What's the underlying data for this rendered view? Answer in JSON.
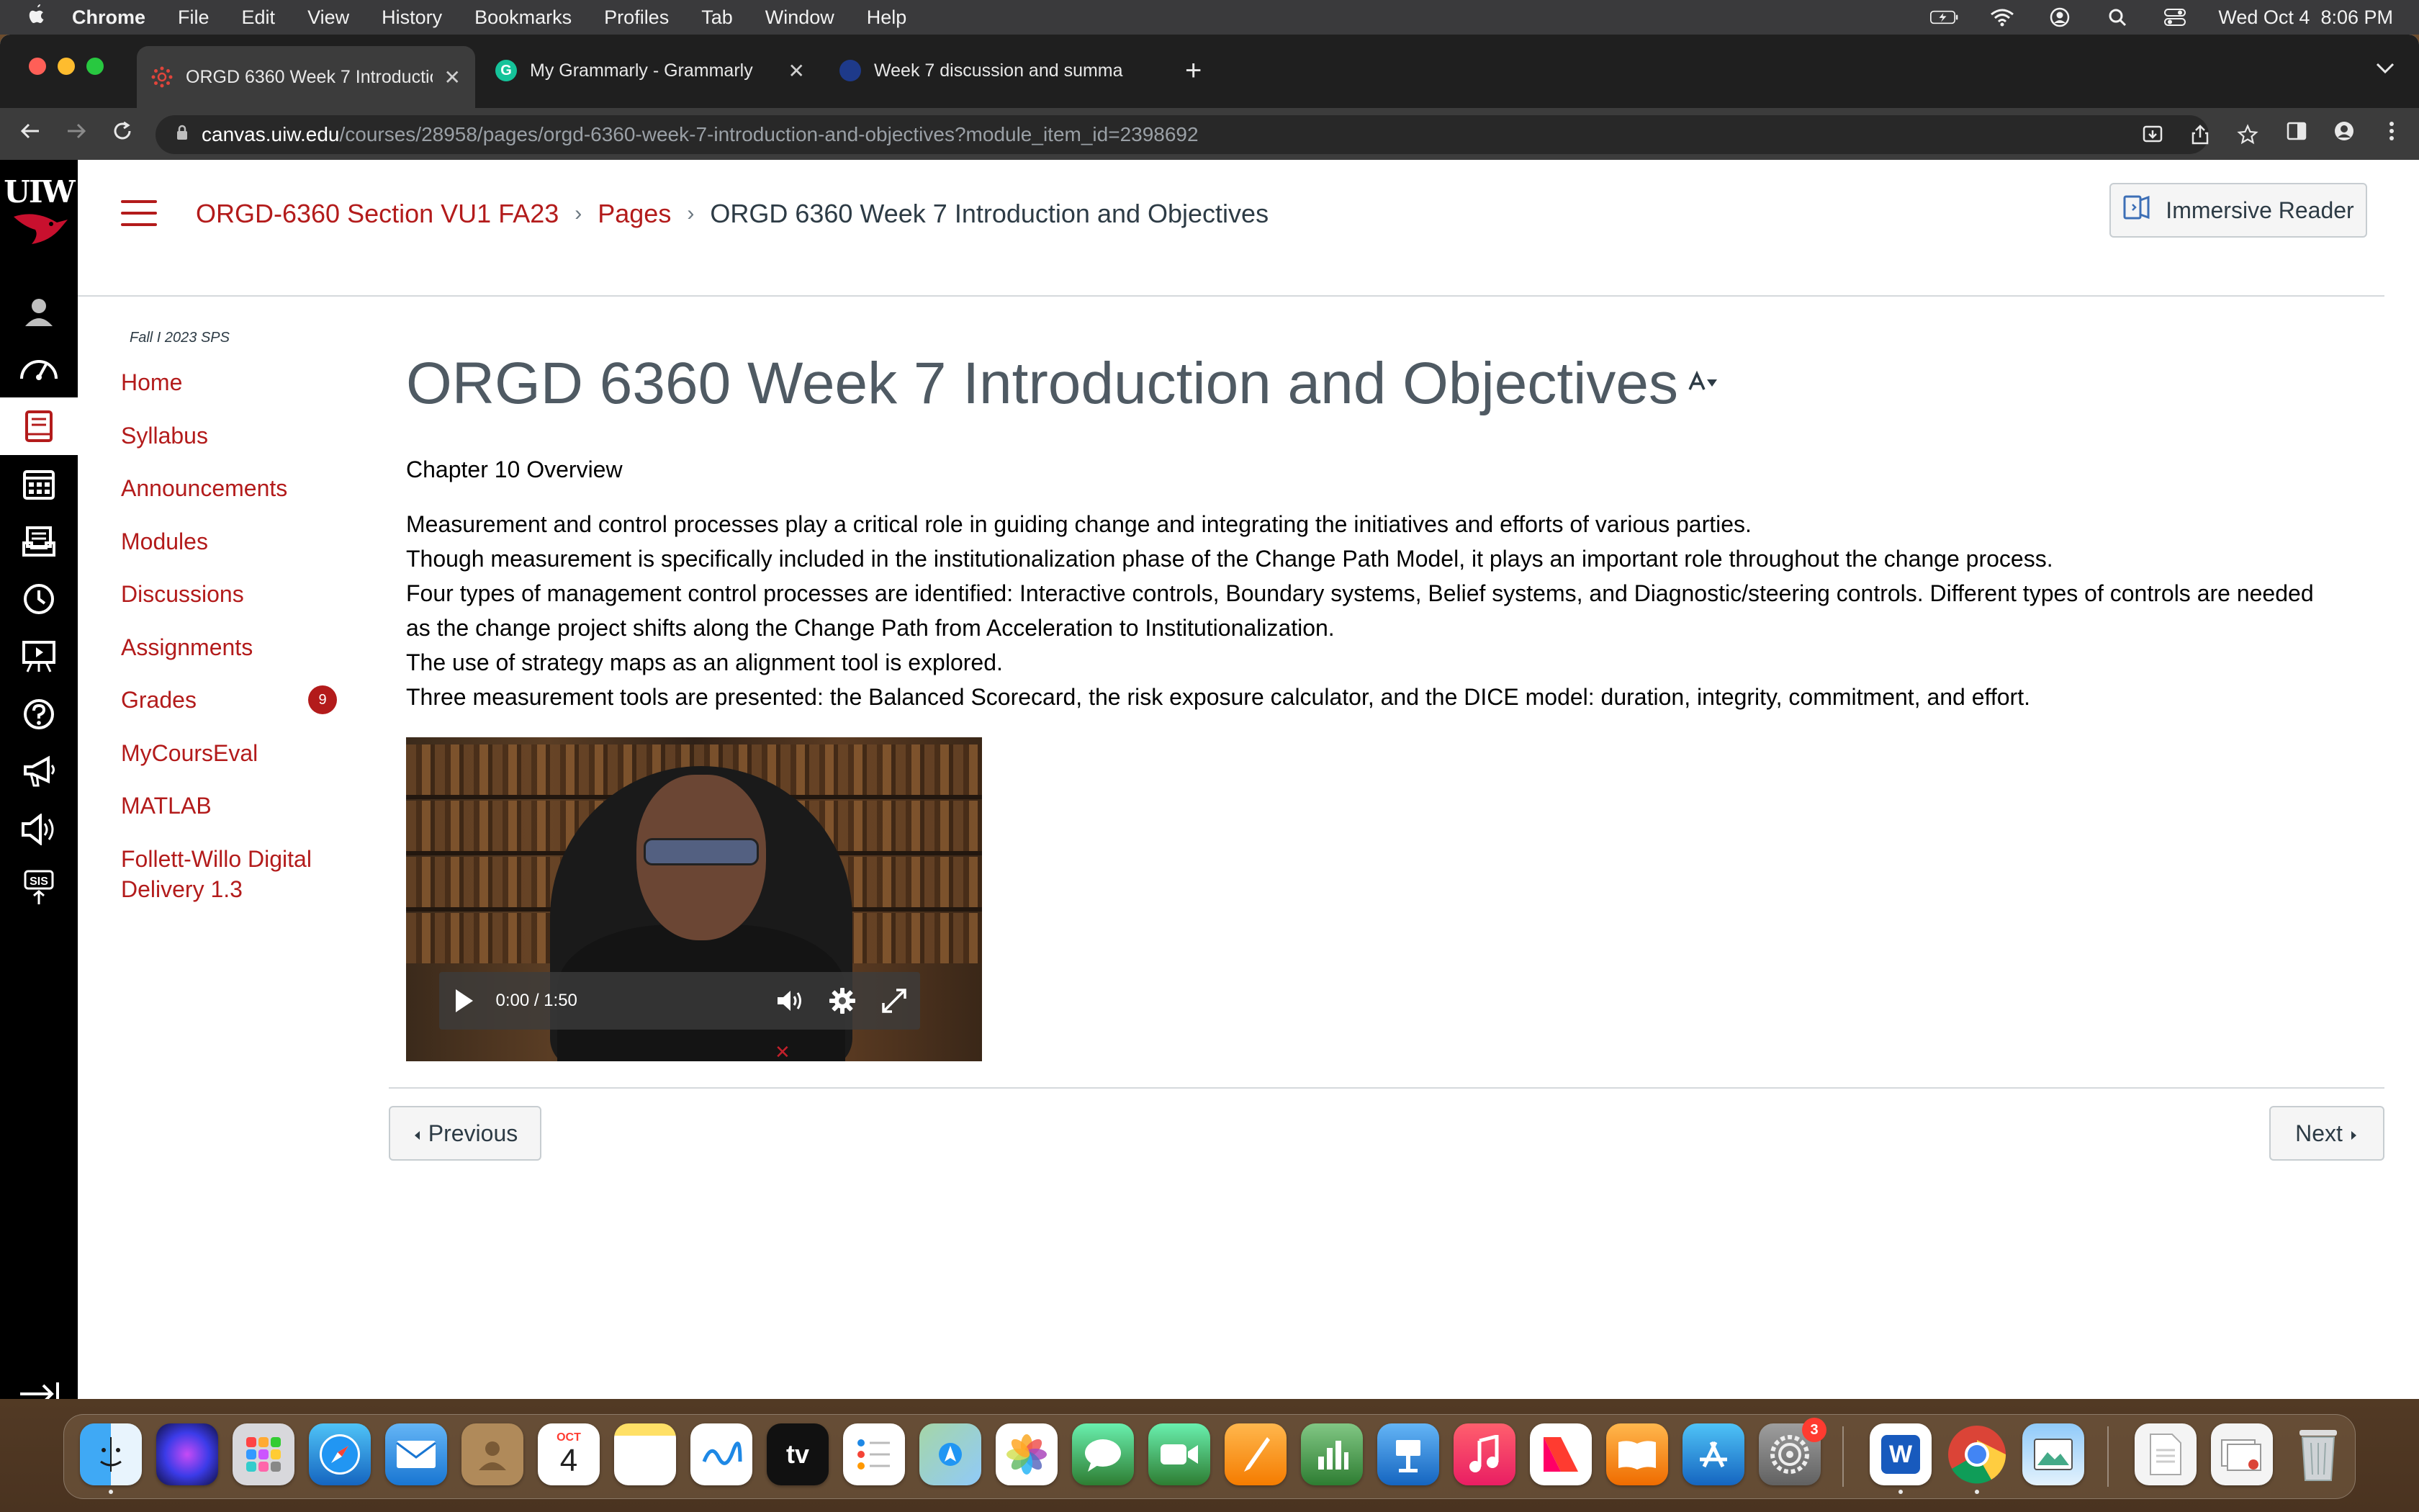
{
  "menubar": {
    "app": "Chrome",
    "items": [
      "File",
      "Edit",
      "View",
      "History",
      "Bookmarks",
      "Profiles",
      "Tab",
      "Window",
      "Help"
    ],
    "clock": "Wed Oct 4  8:06 PM",
    "icons": [
      "battery-icon",
      "wifi-icon",
      "user-icon",
      "spotlight-icon",
      "control-center-icon"
    ]
  },
  "browser": {
    "tabs": [
      {
        "title": "ORGD 6360 Week 7 Introductio",
        "favicon_color": "#b31b1b",
        "active": true
      },
      {
        "title": "My Grammarly - Grammarly",
        "favicon_color": "#15c39a",
        "active": false
      },
      {
        "title": "Week 7 discussion and summa",
        "favicon_color": "#1e3a8a",
        "active": false
      }
    ],
    "url_host": "canvas.uiw.edu",
    "url_path": "/courses/28958/pages/orgd-6360-week-7-introduction-and-objectives?module_item_id=2398692"
  },
  "header": {
    "breadcrumb": {
      "course": "ORGD-6360 Section VU1 FA23",
      "section": "Pages",
      "current": "ORGD 6360 Week 7 Introduction and Objectives"
    },
    "immersive_reader": "Immersive Reader"
  },
  "global_nav": {
    "logo": "UIW",
    "icons": [
      "account-icon",
      "dashboard-icon",
      "courses-icon",
      "calendar-icon",
      "inbox-icon",
      "history-icon",
      "studio-icon",
      "help-icon",
      "announcements-icon",
      "speaker-icon",
      "sis-icon"
    ]
  },
  "course_nav": {
    "term": "Fall I 2023 SPS",
    "items": [
      "Home",
      "Syllabus",
      "Announcements",
      "Modules",
      "Discussions",
      "Assignments",
      "Grades",
      "MyCoursEval",
      "MATLAB",
      "Follett-Willo Digital Delivery 1.3"
    ],
    "grades_badge": "9"
  },
  "content": {
    "title": "ORGD 6360 Week 7 Introduction and Objectives",
    "subtitle": "Chapter 10 Overview",
    "paragraphs": [
      "Measurement and control processes play a critical role in guiding change and integrating the initiatives and efforts of various parties.",
      "Though measurement is specifically included in the institutionalization phase of the Change Path Model, it plays an important role throughout the change process.",
      "Four types of management control processes are identified: Interactive controls, Boundary systems, Belief systems, and Diagnostic/steering controls. Different types of controls are needed as the change project shifts along the Change Path from Acceleration to Institutionalization.",
      "The use of strategy maps as an alignment tool is explored.",
      "Three measurement tools are presented: the Balanced Scorecard, the risk exposure calculator, and the DICE model: duration, integrity, commitment, and effort."
    ],
    "video": {
      "time": "0:00 / 1:50",
      "progress": 0
    }
  },
  "pager": {
    "previous": "Previous",
    "next": "Next"
  },
  "dock": {
    "calendar_month": "OCT",
    "calendar_day": "4",
    "system_settings_badge": "3",
    "word_label": "W"
  },
  "colors": {
    "canvas_red": "#b31b1b",
    "global_nav_bg": "#000000",
    "text": "#2d3b45"
  }
}
